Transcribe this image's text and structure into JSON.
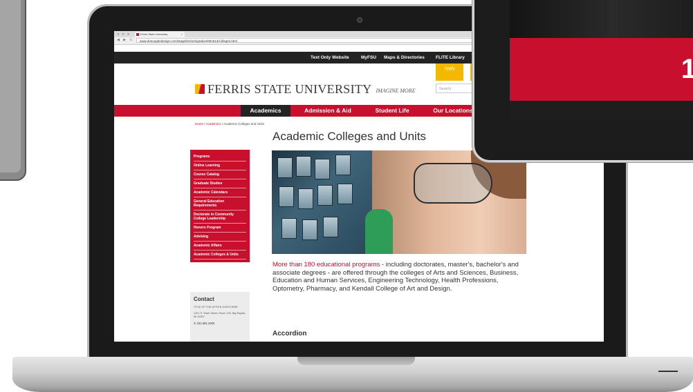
{
  "browser": {
    "tab_title": "Ferris State University",
    "url": "www.donoughedesign.com/stage/ferris/migration/061613/colleges.html"
  },
  "site": {
    "top_links": [
      "Text Only Website",
      "MyFSU",
      "Maps & Directories",
      "FLITE Library"
    ],
    "apply_label": "Apply",
    "search_placeholder": "Search",
    "logo_text": "FERRIS STATE UNIVERSITY",
    "logo_tagline": "IMAGINE MORE",
    "main_nav": [
      "Academics",
      "Admission & Aid",
      "Student Life",
      "Our Locations"
    ],
    "breadcrumb": {
      "home": "Home",
      "sep1": " / ",
      "academics": "Academics",
      "sep2": " / ",
      "current": "Academic Colleges and Units"
    },
    "page_title": "Academic Colleges and Units",
    "side_menu": [
      "Programs",
      "Online Learning",
      "Course Catalog",
      "Graduate Studies",
      "Academic Calendars",
      "General Education Requirements",
      "Doctorate in Community College Leadership",
      "Honors Program",
      "Advising",
      "Academic Affairs",
      "Academic Colleges & Units"
    ],
    "contact": {
      "heading": "Contact",
      "office": "TITLE OF THE OFFICE GOES HERE",
      "address": "1201 S. State Street, Room 100, Big Rapids, MI 49307",
      "phone": "231.591.2000"
    },
    "intro_highlight": "More than 180 educational programs",
    "intro_rest": " - including doctorates, master's, bachelor's and associate degrees - are offered through the colleges of Arts and Sciences, Business, Education and Human Services, Engineering Technology, Health Professions, Optometry, Pharmacy, and Kendall College of Art and Design.",
    "accordion_heading": "Accordion"
  },
  "tablet": {
    "visible_number": "1"
  },
  "colors": {
    "brand_red": "#c8102e",
    "brand_gold": "#f2b900",
    "dark_bar": "#232323"
  }
}
